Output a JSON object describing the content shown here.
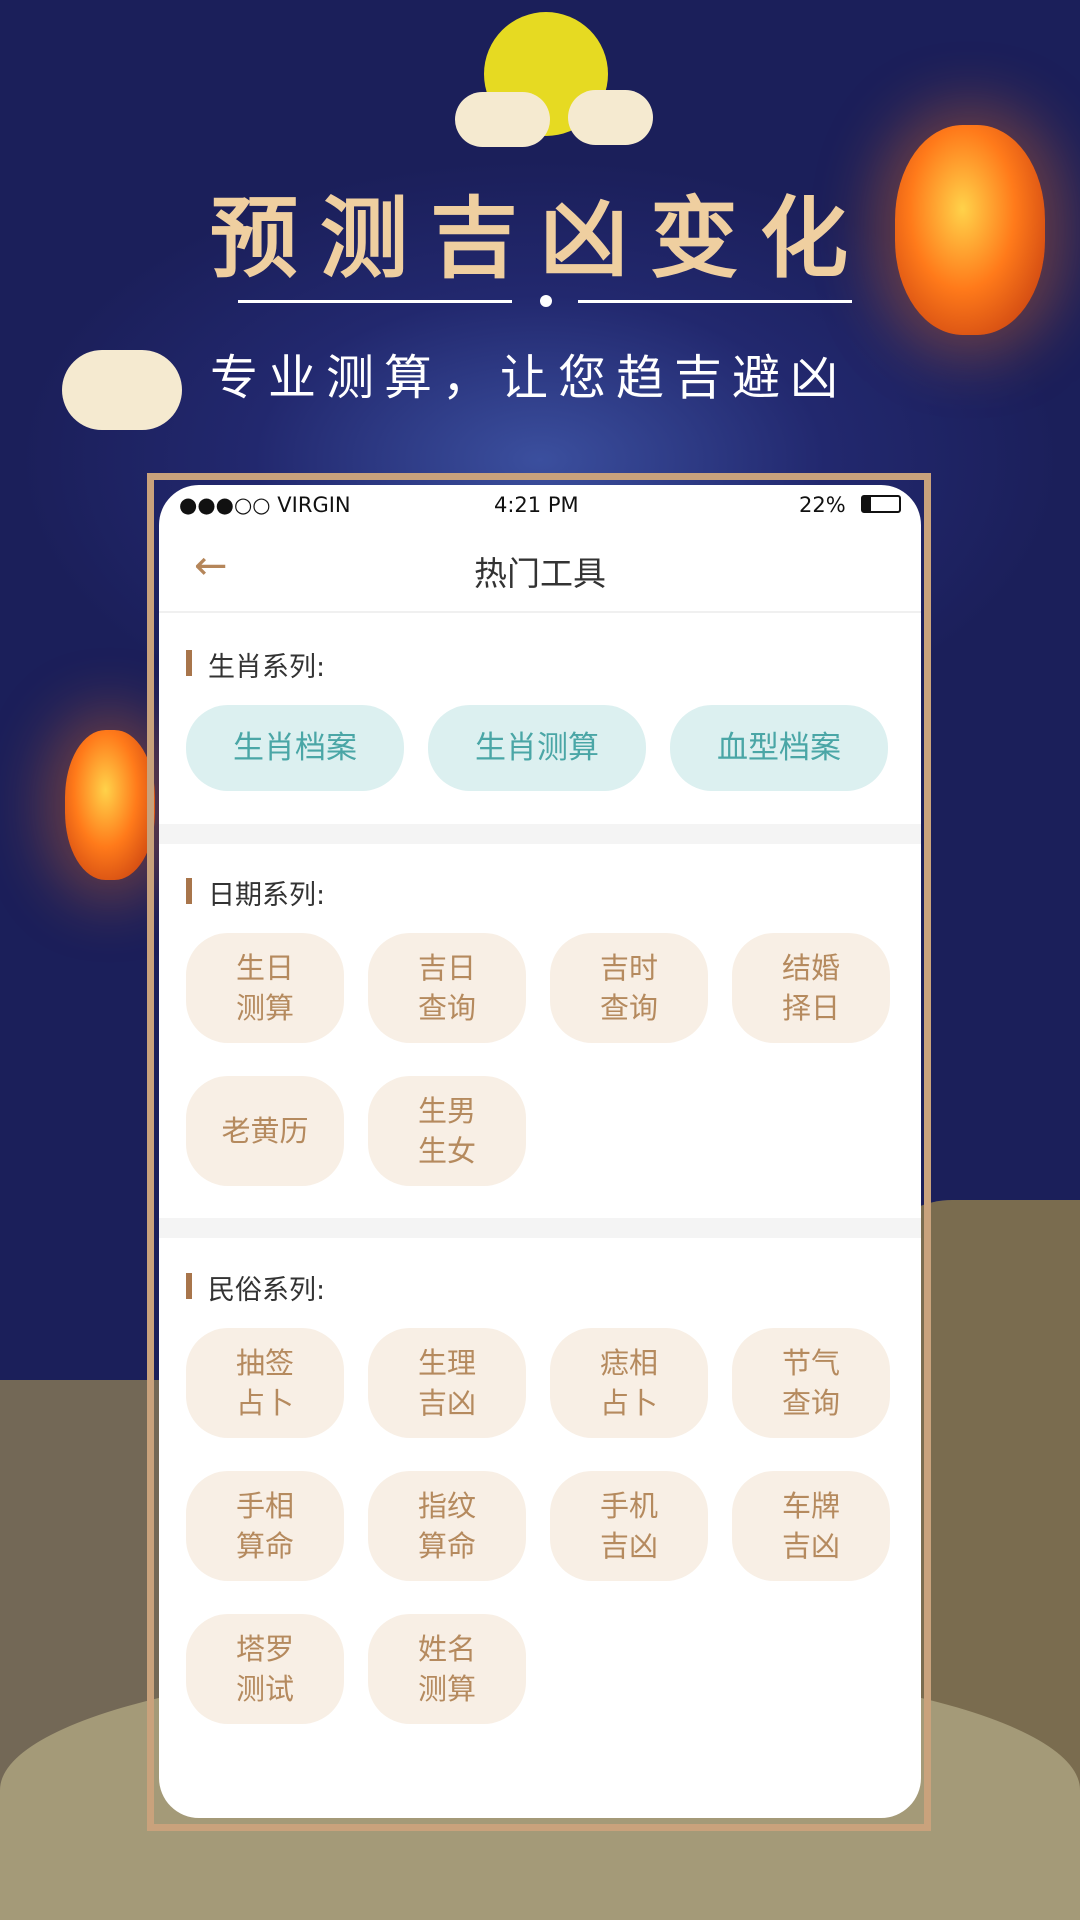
{
  "banner": {
    "headline": "预测吉凶变化",
    "subtitle": "专业测算，让您趋吉避凶"
  },
  "status_bar": {
    "carrier": "●●●○○ VIRGIN",
    "time": "4:21 PM",
    "battery": "22%"
  },
  "nav": {
    "title": "热门工具",
    "back_icon": "arrow-left-icon"
  },
  "colors": {
    "accent": "#a8754b",
    "teal_text": "#4aa6a6",
    "teal_bg": "#dcf0f0",
    "beige_text": "#b58a5e",
    "beige_bg": "#f8efe5"
  },
  "sections": [
    {
      "label": "生肖系列:",
      "items": [
        "生肖档案",
        "生肖测算",
        "血型档案"
      ]
    },
    {
      "label": "日期系列:",
      "items": [
        "生日\n测算",
        "吉日\n查询",
        "吉时\n查询",
        "结婚\n择日",
        "老黄历",
        "生男\n生女"
      ]
    },
    {
      "label": "民俗系列:",
      "items": [
        "抽签\n占卜",
        "生理\n吉凶",
        "痣相\n占卜",
        "节气\n查询",
        "手相\n算命",
        "指纹\n算命",
        "手机\n吉凶",
        "车牌\n吉凶",
        "塔罗\n测试",
        "姓名\n测算"
      ]
    }
  ]
}
